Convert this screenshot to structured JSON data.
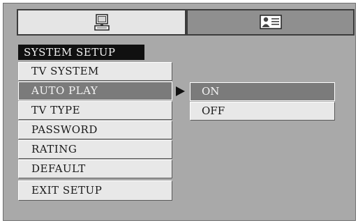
{
  "tabs": [
    {
      "icon": "computer-icon",
      "active": true
    },
    {
      "icon": "user-card-icon",
      "active": false
    }
  ],
  "section_title": "SYSTEM SETUP",
  "menu": {
    "items": [
      {
        "label": "TV SYSTEM"
      },
      {
        "label": "AUTO PLAY",
        "selected": true
      },
      {
        "label": "TV TYPE"
      },
      {
        "label": "PASSWORD"
      },
      {
        "label": "RATING"
      },
      {
        "label": "DEFAULT"
      },
      {
        "label": "EXIT SETUP"
      }
    ]
  },
  "submenu": {
    "options": [
      {
        "label": "ON",
        "selected": true
      },
      {
        "label": "OFF"
      }
    ]
  },
  "colors": {
    "panel": "#a9a9a9",
    "item": "#e8e8e8",
    "selected": "#7b7b7b",
    "title_bg": "#101010"
  }
}
